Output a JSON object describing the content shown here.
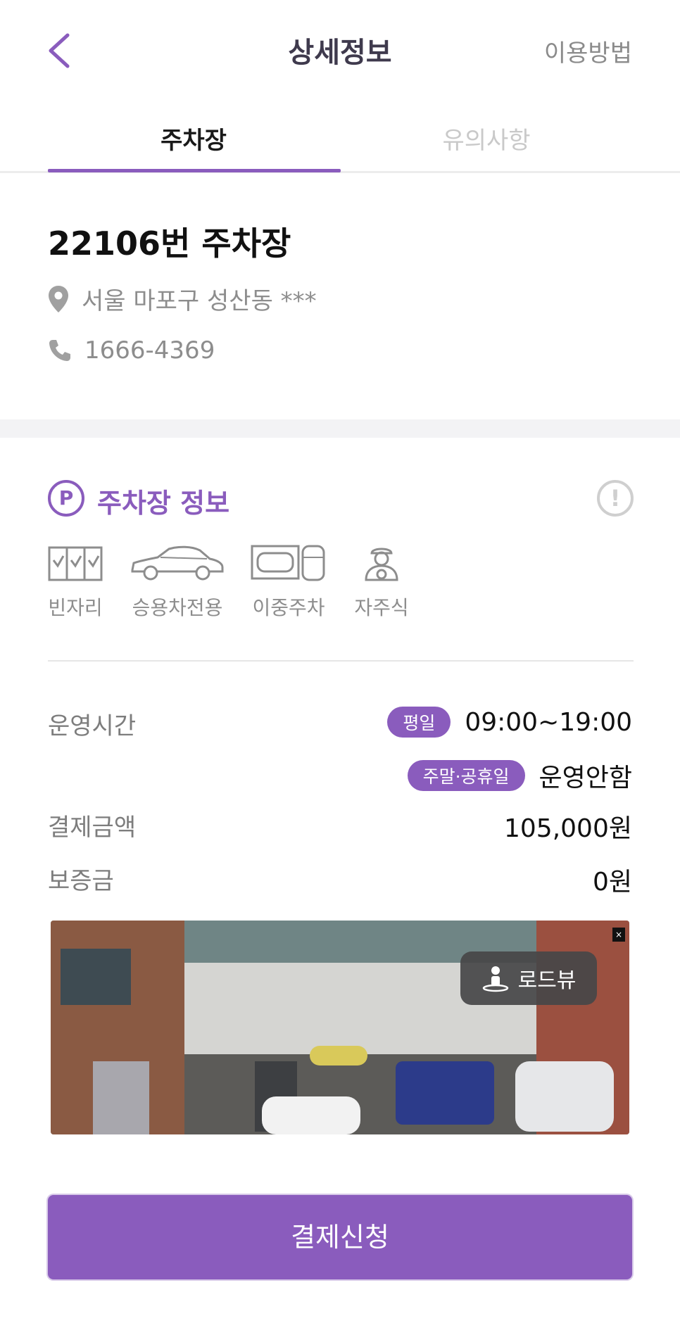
{
  "header": {
    "title": "상세정보",
    "help_label": "이용방법"
  },
  "tabs": [
    {
      "label": "주차장",
      "active": true
    },
    {
      "label": "유의사항",
      "active": false
    }
  ],
  "lot": {
    "name": "22106번 주차장",
    "address": "서울 마포구 성산동 ***",
    "phone": "1666-4369"
  },
  "section": {
    "title": "주차장 정보",
    "p_symbol": "P",
    "notice_symbol": "!"
  },
  "features": [
    {
      "label": "빈자리",
      "icon": "checkbox-grid-icon"
    },
    {
      "label": "승용차전용",
      "icon": "sedan-car-icon"
    },
    {
      "label": "이중주차",
      "icon": "double-parking-icon"
    },
    {
      "label": "자주식",
      "icon": "driver-icon"
    }
  ],
  "operating": {
    "label": "운영시간",
    "weekday_badge": "평일",
    "weekday_hours": "09:00~19:00",
    "holiday_badge": "주말·공휴일",
    "holiday_hours": "운영안함"
  },
  "payment": {
    "label": "결제금액",
    "value": "105,000원"
  },
  "deposit": {
    "label": "보증금",
    "value": "0원"
  },
  "roadview": {
    "label": "로드뷰",
    "close": "×"
  },
  "cta": {
    "label": "결제신청"
  },
  "colors": {
    "accent": "#8a5cbd",
    "muted": "#8d8d8d"
  }
}
